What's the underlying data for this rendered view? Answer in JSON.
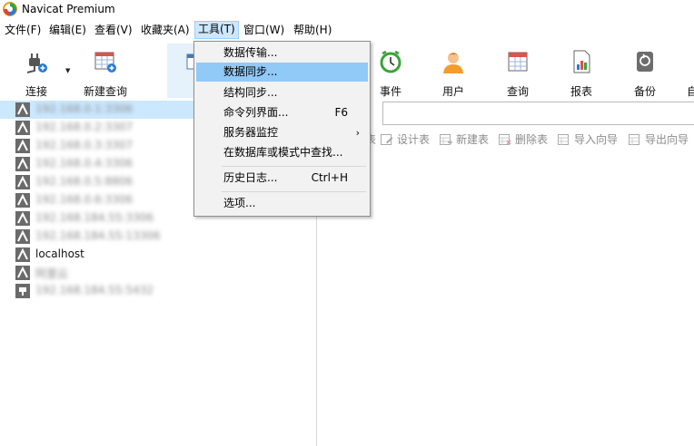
{
  "window": {
    "title": "Navicat Premium"
  },
  "menubar": [
    "文件(F)",
    "编辑(E)",
    "查看(V)",
    "收藏夹(A)",
    "工具(T)",
    "窗口(W)",
    "帮助(H)"
  ],
  "toolbar": {
    "connect": "连接",
    "new_query": "新建查询",
    "event": "事件",
    "user": "用户",
    "query": "查询",
    "report": "报表",
    "backup": "备份",
    "auto_partial": "自"
  },
  "tools_menu": {
    "items": [
      "数据传输...",
      "数据同步...",
      "结构同步...",
      "命令列界面...",
      "服务器监控",
      "在数据库或模式中查找...",
      "历史日志...",
      "选项..."
    ],
    "highlighted": "数据同步...",
    "shortcuts": {
      "command_line": "F6",
      "history": "Ctrl+H"
    }
  },
  "connections": [
    {
      "label": "192.168.0.1:3306",
      "blurred": true
    },
    {
      "label": "192.168.0.2:3307",
      "blurred": true
    },
    {
      "label": "192.168.0.3:3307",
      "blurred": true
    },
    {
      "label": "192.168.0.4:3306",
      "blurred": true
    },
    {
      "label": "192.168.0.5:8806",
      "blurred": true
    },
    {
      "label": "192.168.0.6:3306",
      "blurred": true
    },
    {
      "label": "192.168.184.55:3306",
      "blurred": true
    },
    {
      "label": "192.168.184.55:13306",
      "blurred": true
    },
    {
      "label": "localhost",
      "blurred": false
    },
    {
      "label": "阿里云",
      "blurred": true
    },
    {
      "label": "192.168.184.55:5432",
      "blurred": true
    }
  ],
  "object_toolbar": {
    "partial": "表",
    "design": "设计表",
    "new": "新建表",
    "delete": "删除表",
    "import": "导入向导",
    "export": "导出向导"
  },
  "colors": {
    "menu_highlight": "#91c9f7",
    "selection": "#cce8ff",
    "accent": "#2a7bd4"
  }
}
